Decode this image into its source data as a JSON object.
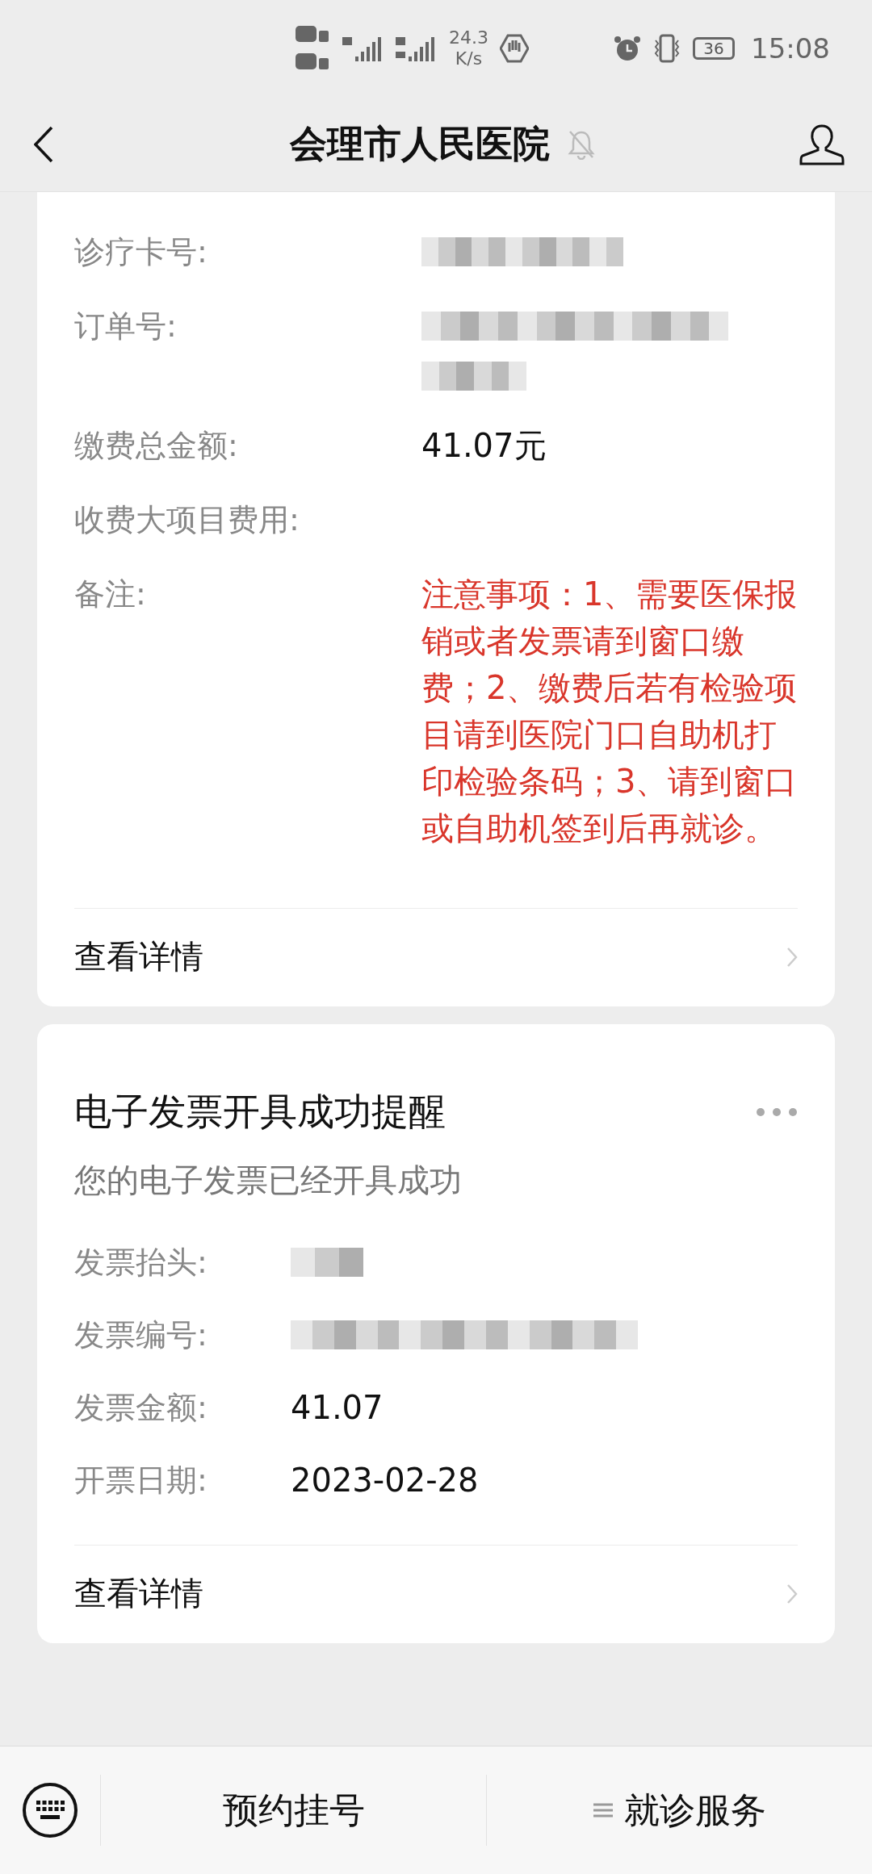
{
  "status_bar": {
    "speed": "24.3",
    "speed_unit": "K/s",
    "battery": "36",
    "time": "15:08"
  },
  "header": {
    "title": "会理市人民医院",
    "muted": true
  },
  "cards": [
    {
      "fields": [
        {
          "label": "诊疗卡号:",
          "kind": "redacted"
        },
        {
          "label": "订单号:",
          "kind": "redacted"
        },
        {
          "label": "缴费总金额:",
          "kind": "text",
          "value": "41.07元"
        },
        {
          "label": "收费大项目费用:",
          "kind": "blank"
        },
        {
          "label": "备注:",
          "kind": "notice",
          "value": "注意事项：1、需要医保报销或者发票请到窗口缴费；2、缴费后若有检验项目请到医院门口自助机打印检验条码；3、请到窗口或自助机签到后再就诊。"
        }
      ],
      "link": "查看详情"
    },
    {
      "title": "电子发票开具成功提醒",
      "subtitle": "您的电子发票已经开具成功",
      "fields": [
        {
          "label": "发票抬头:",
          "kind": "redacted"
        },
        {
          "label": "发票编号:",
          "kind": "redacted"
        },
        {
          "label": "发票金额:",
          "kind": "text",
          "value": "41.07"
        },
        {
          "label": "开票日期:",
          "kind": "text",
          "value": "2023-02-28"
        }
      ],
      "link": "查看详情"
    }
  ],
  "bottom_menu": [
    {
      "label": "预约挂号",
      "has_submenu": false
    },
    {
      "label": "就诊服务",
      "has_submenu": true
    }
  ]
}
